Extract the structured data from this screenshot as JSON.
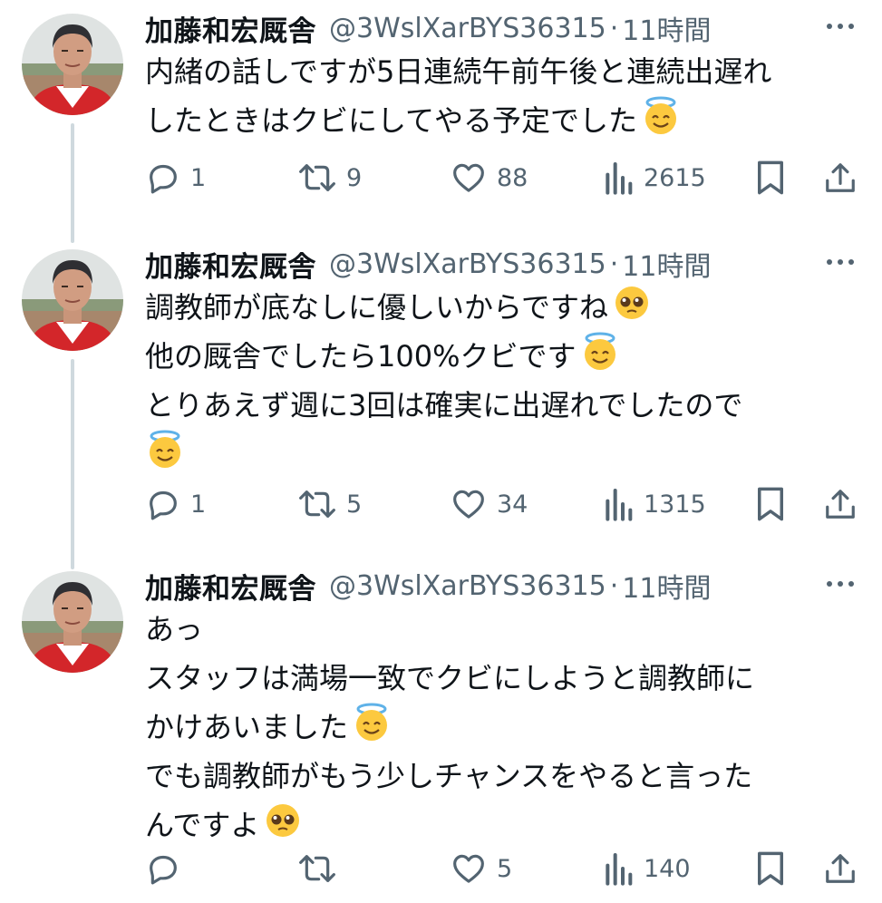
{
  "tweets": [
    {
      "author_name": "加藤和宏厩舎",
      "author_handle": "@3WslXarBYS36315",
      "separator": "·",
      "time": "11時間",
      "lines": [
        "内緒の話しですが5日連続午前午後と連続出遅れ",
        "したときはクビにしてやる予定でした"
      ],
      "emojis": [
        "smiling-face-with-halo"
      ],
      "replies": "1",
      "retweets": "9",
      "likes": "88",
      "views": "2615"
    },
    {
      "author_name": "加藤和宏厩舎",
      "author_handle": "@3WslXarBYS36315",
      "separator": "·",
      "time": "11時間",
      "lines": [
        "調教師が底なしに優しいからですね",
        "他の厩舎でしたら100%クビです",
        "とりあえず週に3回は確実に出遅れでしたので"
      ],
      "emojis": [
        "pleading-face",
        "smiling-face-with-halo",
        "smiling-face-with-halo"
      ],
      "replies": "1",
      "retweets": "5",
      "likes": "34",
      "views": "1315"
    },
    {
      "author_name": "加藤和宏厩舎",
      "author_handle": "@3WslXarBYS36315",
      "separator": "·",
      "time": "11時間",
      "lines": [
        "あっ",
        "スタッフは満場一致でクビにしようと調教師に",
        "かけあいました",
        "でも調教師がもう少しチャンスをやると言った",
        "んですよ"
      ],
      "emojis": [
        "smiling-face-with-halo",
        "pleading-face"
      ],
      "replies": "",
      "retweets": "",
      "likes": "5",
      "views": "140"
    }
  ],
  "colors": {
    "text": "#0f1419",
    "secondary": "#536471",
    "thread_line": "#cfd9de",
    "avatar_jacket": "#d3262a"
  },
  "icons": [
    "reply-icon",
    "retweet-icon",
    "like-icon",
    "views-icon",
    "bookmark-icon",
    "share-icon",
    "more-icon"
  ]
}
